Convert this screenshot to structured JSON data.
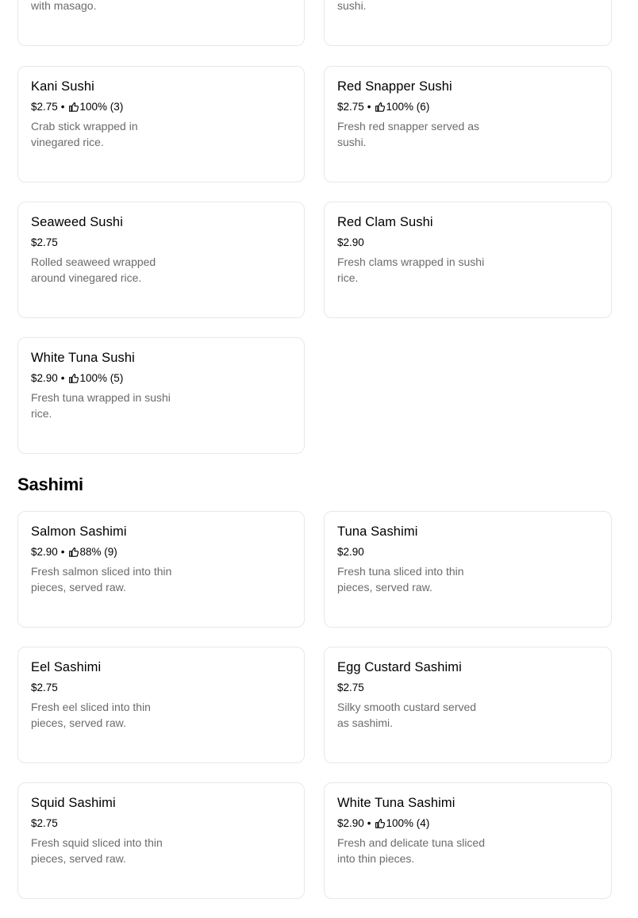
{
  "top_partial": {
    "left_desc_tail": "with masago.",
    "right_desc_tail": "sushi."
  },
  "sushi_items": [
    {
      "name": "Kani Sushi",
      "price": "$2.75",
      "rating": "100% (3)",
      "desc": "Crab stick wrapped in vinegared rice."
    },
    {
      "name": "Red Snapper Sushi",
      "price": "$2.75",
      "rating": "100% (6)",
      "desc": "Fresh red snapper served as sushi."
    },
    {
      "name": "Seaweed Sushi",
      "price": "$2.75",
      "rating": "",
      "desc": "Rolled seaweed wrapped around vinegared rice."
    },
    {
      "name": "Red Clam Sushi",
      "price": "$2.90",
      "rating": "",
      "desc": "Fresh clams wrapped in sushi rice."
    },
    {
      "name": "White Tuna Sushi",
      "price": "$2.90",
      "rating": "100% (5)",
      "desc": "Fresh tuna wrapped in sushi rice."
    }
  ],
  "sashimi_section": {
    "title": "Sashimi",
    "items": [
      {
        "name": "Salmon Sashimi",
        "price": "$2.90",
        "rating": "88% (9)",
        "desc": "Fresh salmon sliced into thin pieces, served raw."
      },
      {
        "name": "Tuna Sashimi",
        "price": "$2.90",
        "rating": "",
        "desc": "Fresh tuna sliced into thin pieces, served raw."
      },
      {
        "name": "Eel Sashimi",
        "price": "$2.75",
        "rating": "",
        "desc": "Fresh eel sliced into thin pieces, served raw."
      },
      {
        "name": "Egg Custard Sashimi",
        "price": "$2.75",
        "rating": "",
        "desc": "Silky smooth custard served as sashimi."
      },
      {
        "name": "Squid Sashimi",
        "price": "$2.75",
        "rating": "",
        "desc": "Fresh squid sliced into thin pieces, served raw."
      },
      {
        "name": "White Tuna Sashimi",
        "price": "$2.90",
        "rating": "100% (4)",
        "desc": "Fresh and delicate tuna sliced into thin pieces."
      }
    ]
  },
  "rating_separator": "•",
  "icons": {
    "rating": "thumbs-up-icon"
  },
  "colors": {
    "border": "#e8e8e8",
    "description": "#6b6b6b",
    "text": "#000000"
  }
}
